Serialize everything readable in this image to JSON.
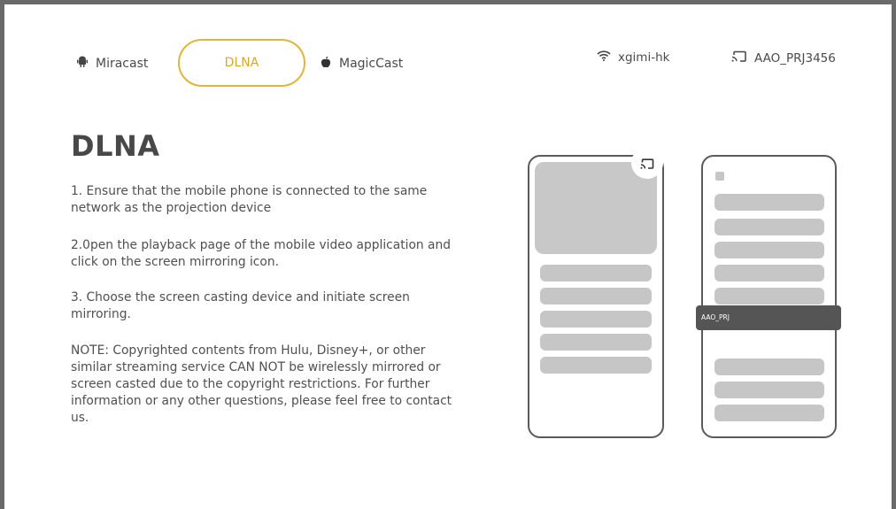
{
  "tabs": [
    {
      "label": "Miracast",
      "icon": "android-icon"
    },
    {
      "label": "DLNA",
      "active": true
    },
    {
      "label": "MagicCast",
      "icon": "apple-icon"
    }
  ],
  "status": {
    "wifi": {
      "label": "xgimi-hk",
      "icon": "wifi-icon"
    },
    "device": {
      "label": "AAO_PRJ3456",
      "icon": "cast-icon"
    }
  },
  "content": {
    "title": "DLNA",
    "step1": "1. Ensure that the mobile phone is connected to the same network as the projection device",
    "step2": "2.0pen the playback page of the mobile video application and click on the screen mirroring icon.",
    "step3": "3. Choose the screen casting device and initiate screen mirroring.",
    "note": "NOTE: Copyrighted contents from Hulu, Disney+, or other similar streaming service CAN NOT be wirelessly mirrored or screen casted due to the copyright restrictions. For further information or any other questions, please feel free to contact us."
  },
  "illustration": {
    "popup_label": "AAO_PRJ"
  },
  "colors": {
    "accent": "#e2b53a",
    "frame": "#6a6a6a"
  }
}
